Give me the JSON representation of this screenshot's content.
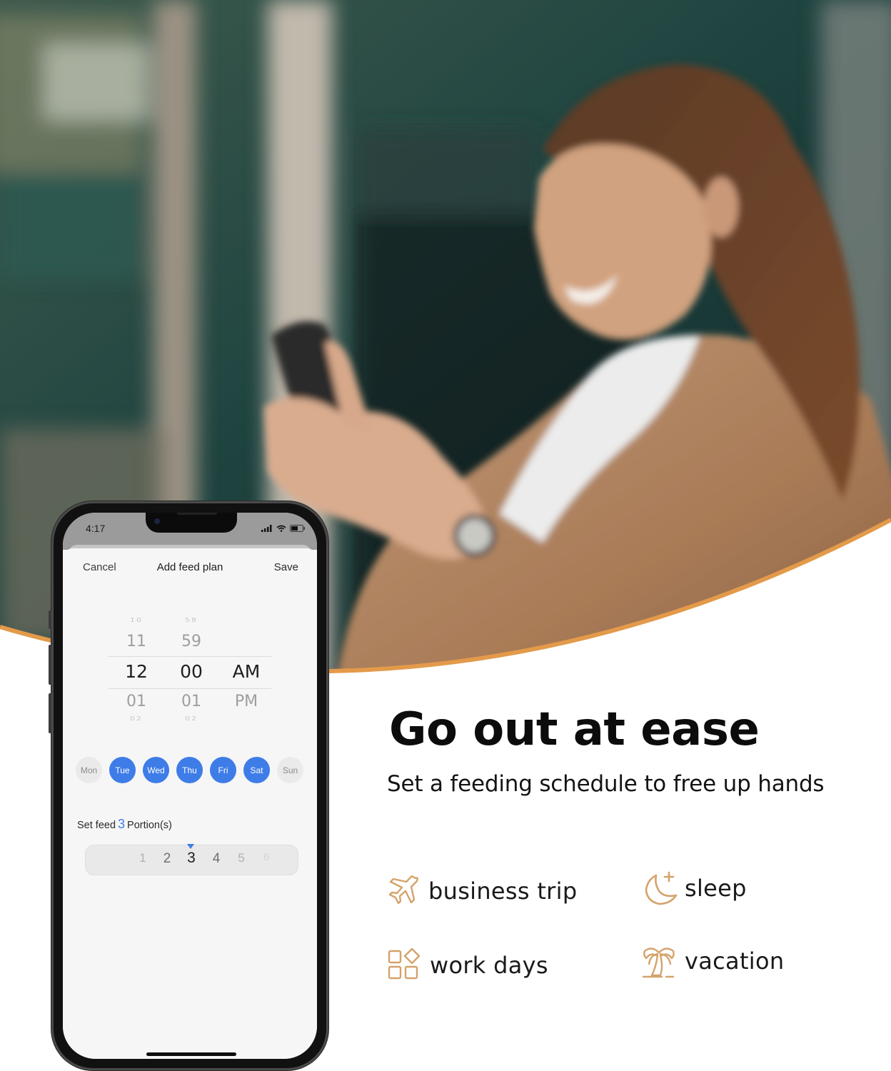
{
  "colors": {
    "accent_orange": "#e39a4a",
    "icon_tan": "#d4a36a",
    "app_blue": "#3e7ce8",
    "headline": "#0c0c0c",
    "day_inactive_bg": "#eaeaea"
  },
  "marketing": {
    "headline": "Go out at ease",
    "subheadline": "Set a feeding schedule to free up hands",
    "features": [
      {
        "icon": "airplane-icon",
        "label": "business trip"
      },
      {
        "icon": "moon-plus-icon",
        "label": "sleep"
      },
      {
        "icon": "shapes-grid-icon",
        "label": "work days"
      },
      {
        "icon": "palm-tree-icon",
        "label": "vacation"
      }
    ]
  },
  "phone": {
    "status_bar": {
      "time": "4:17",
      "icons": [
        "cellular-signal-icon",
        "wifi-icon",
        "battery-icon"
      ]
    },
    "nav": {
      "cancel_label": "Cancel",
      "title": "Add feed plan",
      "save_label": "Save"
    },
    "time_picker": {
      "hours": {
        "far_above": "10",
        "above": "11",
        "selected": "12",
        "below": "01",
        "far_below": "02"
      },
      "minutes": {
        "far_above": "58",
        "above": "59",
        "selected": "00",
        "below": "01",
        "far_below": "02"
      },
      "period": {
        "selected": "AM",
        "below": "PM"
      }
    },
    "days": [
      {
        "label": "Mon",
        "selected": false
      },
      {
        "label": "Tue",
        "selected": true
      },
      {
        "label": "Wed",
        "selected": true
      },
      {
        "label": "Thu",
        "selected": true
      },
      {
        "label": "Fri",
        "selected": true
      },
      {
        "label": "Sat",
        "selected": true
      },
      {
        "label": "Sun",
        "selected": false
      }
    ],
    "portions": {
      "prefix": "Set feed",
      "value": "3",
      "suffix": "Portion(s)",
      "scale": [
        "1",
        "2",
        "3",
        "4",
        "5",
        "6"
      ],
      "selected": "3"
    }
  }
}
